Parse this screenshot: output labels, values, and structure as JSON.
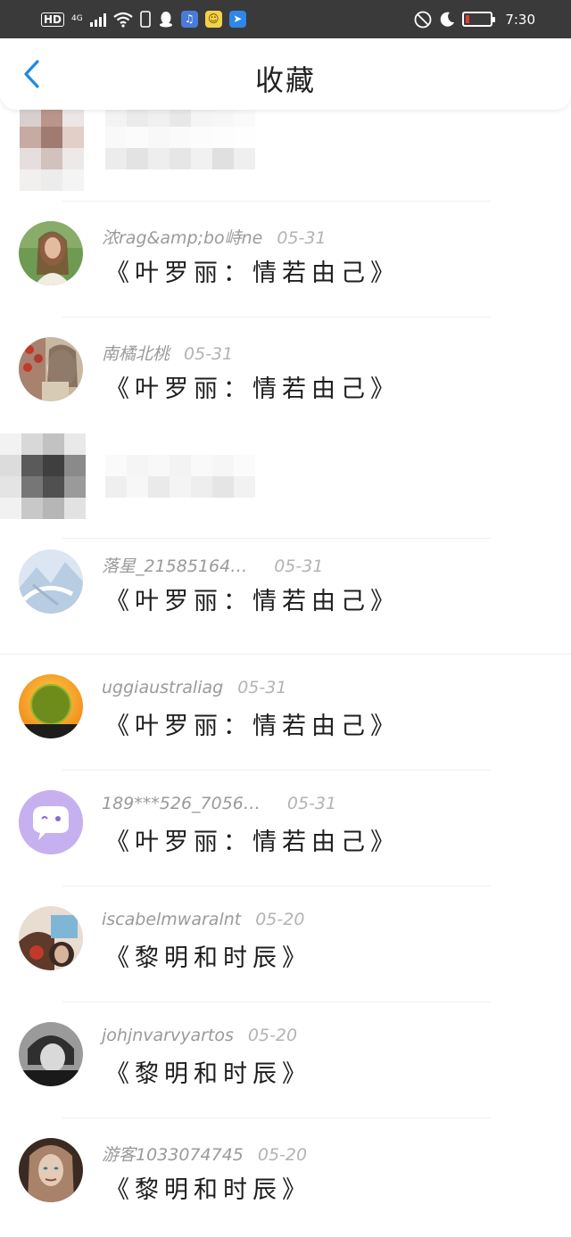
{
  "status_bar": {
    "hd": "HD",
    "network": "4G",
    "time": "7:30"
  },
  "header": {
    "title": "收藏",
    "back_icon": "chevron-left-icon",
    "accent": "#1e88e5"
  },
  "items": [
    {
      "user": "浓rag&amp;bo峙ne",
      "date": "05-31",
      "content": "《叶罗丽：情若由己》"
    },
    {
      "user": "南橘北桃",
      "date": "05-31",
      "content": "《叶罗丽：情若由己》"
    },
    {
      "user": "落星_21585164…",
      "date": "05-31",
      "content": "《叶罗丽：情若由己》"
    },
    {
      "user": "uggiaustraliag",
      "date": "05-31",
      "content": "《叶罗丽：情若由己》"
    },
    {
      "user": "189***526_7056…",
      "date": "05-31",
      "content": "《叶罗丽：情若由己》"
    },
    {
      "user": "iscabelmwaralnt",
      "date": "05-20",
      "content": "《黎明和时辰》"
    },
    {
      "user": "johjnvarvyartos",
      "date": "05-20",
      "content": "《黎明和时辰》"
    },
    {
      "user": "游客1033074745",
      "date": "05-20",
      "content": "《黎明和时辰》"
    }
  ]
}
